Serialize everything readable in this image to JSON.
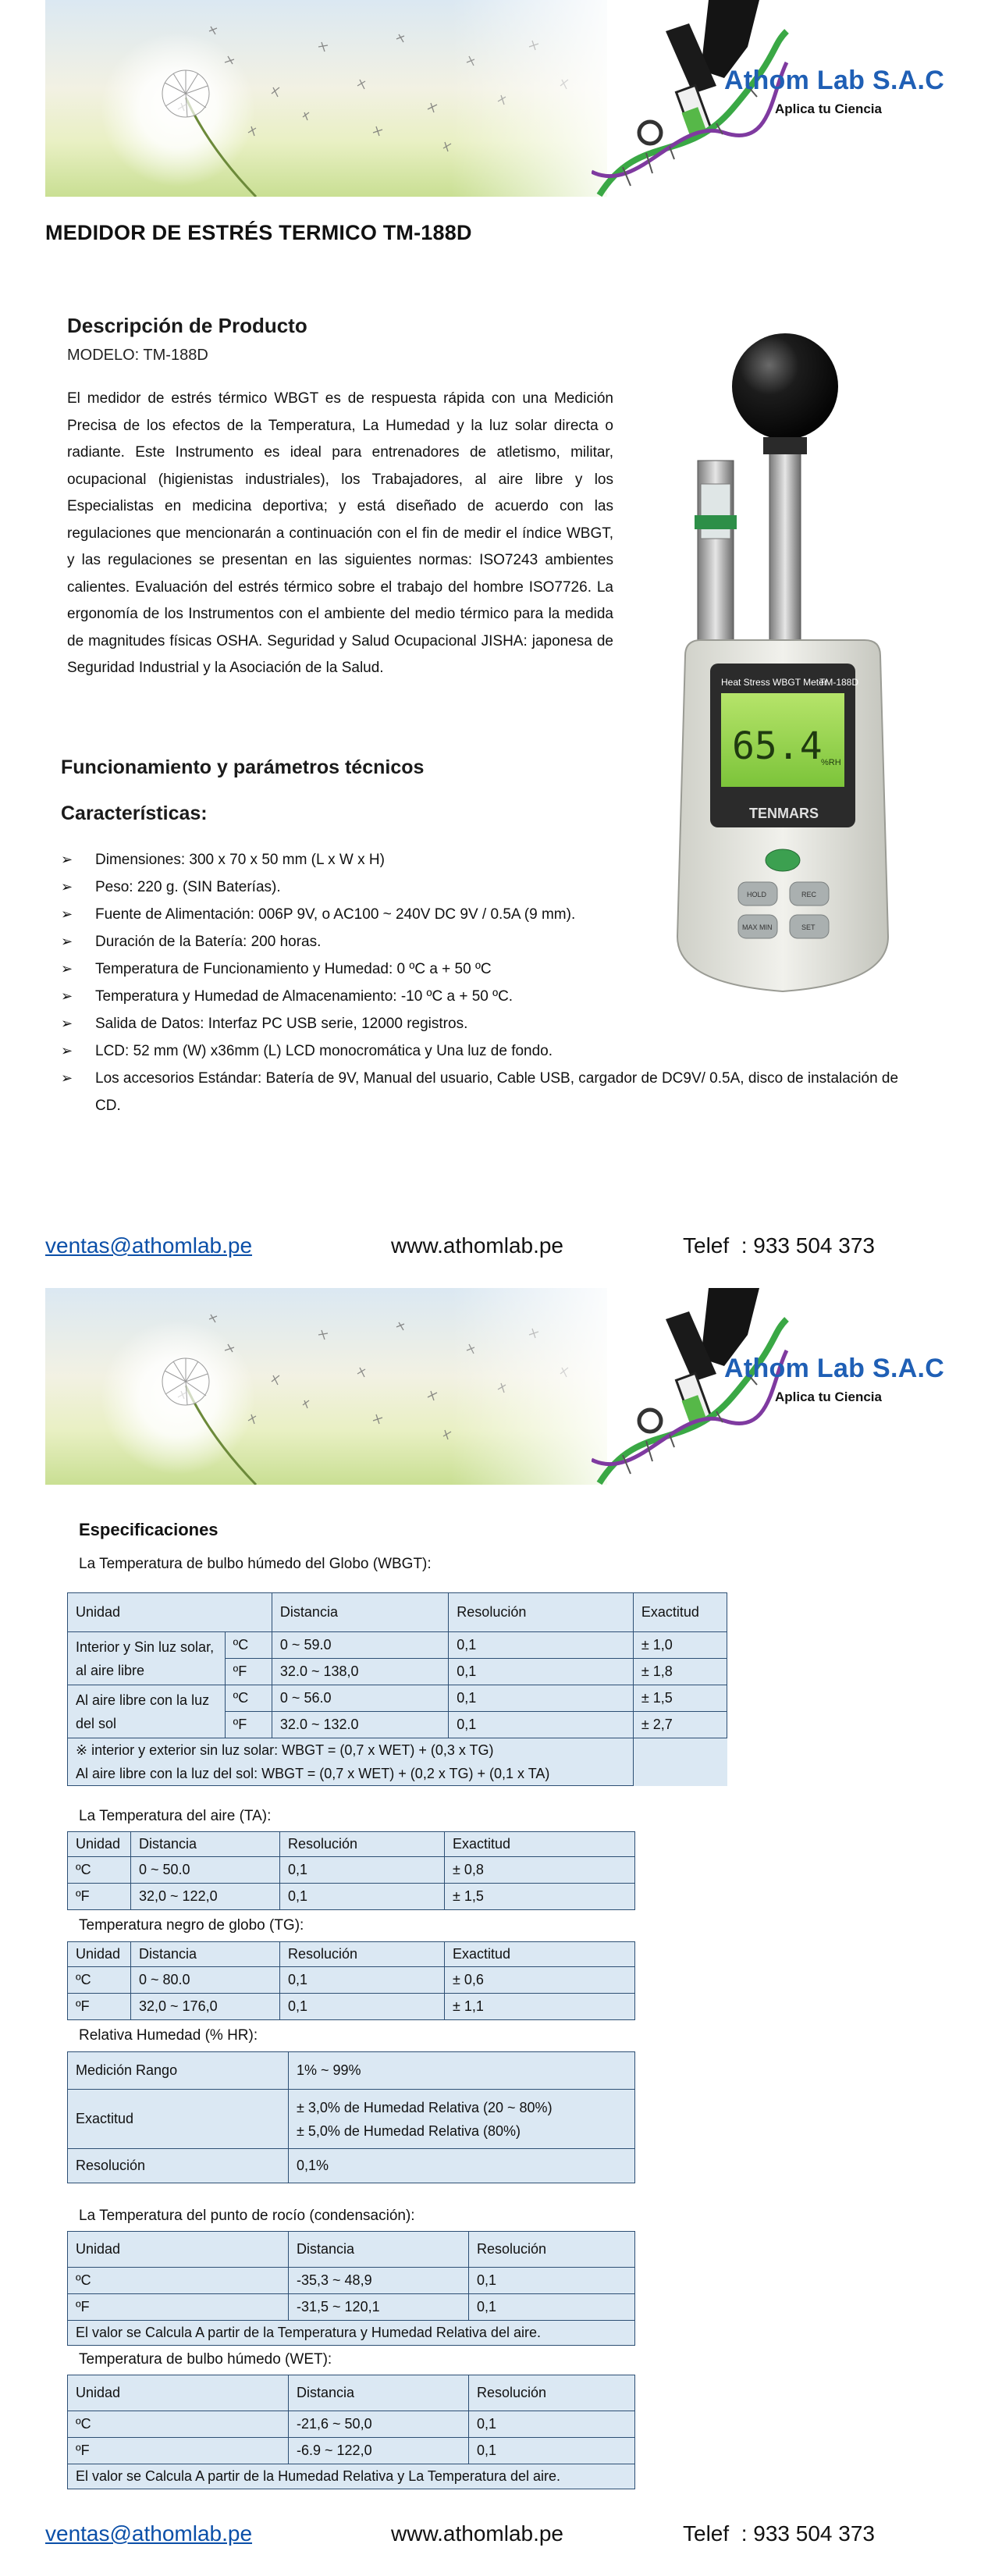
{
  "brand": {
    "name": "Athom Lab S.A.C",
    "tagline": "Aplica tu Ciencia"
  },
  "page_title": "MEDIDOR DE ESTRÉS TERMICO TM-188D",
  "description": {
    "heading": "Descripción de Producto",
    "model": "MODELO: TM-188D",
    "body": "El medidor de estrés térmico WBGT es de respuesta rápida con una Medición Precisa de los efectos de la Temperatura, La Humedad y la luz solar directa o radiante. Este Instrumento es ideal para entrenadores de atletismo, militar, ocupacional (higienistas industriales), los Trabajadores, al aire libre y los Especialistas en medicina deportiva; y está diseñado de acuerdo con las regulaciones que mencionarán a continuación con el fin de medir el índice WBGT, y las regulaciones se presentan en las siguientes normas: ISO7243 ambientes calientes. Evaluación del estrés térmico sobre el trabajo del hombre ISO7726. La ergonomía de los Instrumentos con el ambiente del medio térmico para la medida de magnitudes físicas OSHA. Seguridad y Salud Ocupacional JISHA: japonesa de Seguridad Industrial y la Asociación de la Salud."
  },
  "functioning_heading": "Funcionamiento y parámetros técnicos",
  "features_heading": "Características:",
  "features": [
    "Dimensiones: 300 x 70 x 50 mm (L x W x H)",
    "Peso: 220 g. (SIN Baterías).",
    "Fuente de Alimentación: 006P 9V, o AC100 ~ 240V DC 9V / 0.5A (9 mm).",
    "Duración de la Batería: 200 horas.",
    "Temperatura de Funcionamiento y Humedad: 0 ºC a + 50 ºC",
    "Temperatura y Humedad de Almacenamiento: -10 ºC a + 50 ºC.",
    "Salida de Datos: Interfaz PC USB serie, 12000 registros.",
    "LCD: 52 mm (W) x36mm (L) LCD monocromática y Una luz de fondo.",
    "Los accesorios Estándar: Batería de 9V, Manual del usuario, Cable USB, cargador de DC9V/ 0.5A, disco de instalación de CD."
  ],
  "meter": {
    "label": "Heat Stress WBGT Meter",
    "model": "TM-188D",
    "reading": "65.4",
    "unit": "%RH",
    "brand": "TENMARS",
    "key1": "HOLD",
    "key2": "REC",
    "key3": "MAX MIN",
    "key4": "SET"
  },
  "footer": {
    "email": "ventas@athomlab.pe",
    "website": "www.athomlab.pe",
    "phone": "Telef  : 933 504 373"
  },
  "specs": {
    "heading": "Especificaciones",
    "wbgt": {
      "caption": "La Temperatura de bulbo húmedo del Globo (WBGT):",
      "headers": [
        "Unidad",
        "Distancia",
        "Resolución",
        "Exactitud"
      ],
      "group1": "Interior y Sin luz solar, al aire libre",
      "group2": "Al aire libre con la luz del sol",
      "rows": [
        [
          "ºC",
          "0 ~ 59.0",
          "0,1",
          "± 1,0"
        ],
        [
          "ºF",
          "32.0 ~ 138,0",
          "0,1",
          "± 1,8"
        ],
        [
          "ºC",
          "0 ~ 56.0",
          "0,1",
          "± 1,5"
        ],
        [
          "ºF",
          "32.0 ~ 132.0",
          "0,1",
          "± 2,7"
        ]
      ],
      "note1": "※ interior y exterior sin luz solar: WBGT = (0,7 x WET) + (0,3 x TG)",
      "note2": "Al aire libre con la luz del sol: WBGT = (0,7 x WET) + (0,2 x TG) + (0,1 x TA)"
    },
    "ta": {
      "caption": "La Temperatura del aire (TA):",
      "headers": [
        "Unidad",
        "Distancia",
        "Resolución",
        "Exactitud"
      ],
      "rows": [
        [
          "ºC",
          "0 ~ 50.0",
          "0,1",
          "± 0,8"
        ],
        [
          "ºF",
          "32,0 ~ 122,0",
          "0,1",
          "± 1,5"
        ]
      ]
    },
    "tg": {
      "caption": "Temperatura negro de globo (TG):",
      "headers": [
        "Unidad",
        "Distancia",
        "Resolución",
        "Exactitud"
      ],
      "rows": [
        [
          "ºC",
          "0 ~ 80.0",
          "0,1",
          "± 0,6"
        ],
        [
          "ºF",
          "32,0 ~ 176,0",
          "0,1",
          "± 1,1"
        ]
      ]
    },
    "rh": {
      "caption": "Relativa Humedad (% HR):",
      "range_label": "Medición Rango",
      "range_value": "1% ~ 99%",
      "accuracy_label": "Exactitud",
      "accuracy_value_1": "± 3,0% de Humedad Relativa (20 ~ 80%)",
      "accuracy_value_2": "± 5,0% de Humedad Relativa (80%)",
      "resolution_label": "Resolución",
      "resolution_value": "0,1%"
    },
    "dew": {
      "caption": "La Temperatura del punto de rocío (condensación):",
      "headers": [
        "Unidad",
        "Distancia",
        "Resolución"
      ],
      "rows": [
        [
          "ºC",
          "-35,3 ~ 48,9",
          "0,1"
        ],
        [
          "ºF",
          "-31,5 ~ 120,1",
          "0,1"
        ]
      ],
      "note": "El valor se Calcula A partir de la Temperatura y Humedad Relativa del aire."
    },
    "wet": {
      "caption": "Temperatura de bulbo húmedo (WET):",
      "headers": [
        "Unidad",
        "Distancia",
        "Resolución"
      ],
      "rows": [
        [
          "ºC",
          "-21,6 ~ 50,0",
          "0,1"
        ],
        [
          "ºF",
          "-6.9 ~ 122,0",
          "0,1"
        ]
      ],
      "note": "El valor se Calcula A partir de la Humedad Relativa y La Temperatura del aire."
    }
  }
}
